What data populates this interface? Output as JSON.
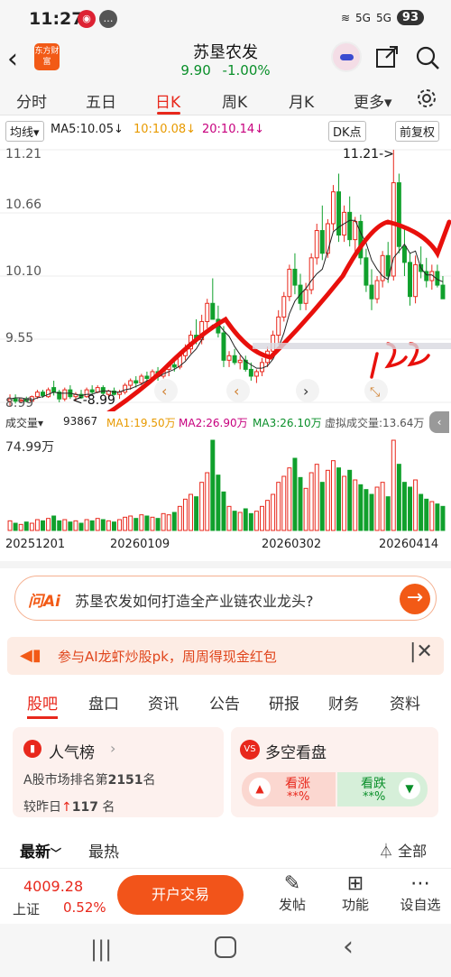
{
  "status": {
    "time": "11:27",
    "net1": "5G",
    "net2": "5G",
    "battery": "93"
  },
  "header": {
    "logo": "东方财富",
    "title": "苏垦农发",
    "price": "9.90",
    "change": "-1.00%"
  },
  "tabs": [
    {
      "label": "分时"
    },
    {
      "label": "五日"
    },
    {
      "label": "日K"
    },
    {
      "label": "周K"
    },
    {
      "label": "月K"
    },
    {
      "label": "更多▾"
    }
  ],
  "ma_bar": {
    "selector": "均线▾",
    "ma5": "MA5:10.05↓",
    "ma10": "10:10.08↓",
    "ma20": "20:10.14↓",
    "dk": "DK点",
    "adjust": "前复权"
  },
  "chart_axis": {
    "y1": "11.21",
    "y2": "10.66",
    "y3": "10.10",
    "y4": "9.55",
    "y5": "8.99",
    "hi_label": "11.21->",
    "lo_label": "<-8.99"
  },
  "vol_bar": {
    "selector": "成交量▾",
    "vol": "93867",
    "ma1": "MA1:19.50万",
    "ma2": "MA2:26.90万",
    "ma3": "MA3:26.10万",
    "virtual": "虚拟成交量:13.64万",
    "max": "74.99万"
  },
  "dates": [
    "20251201",
    "20260109",
    "20260302",
    "20260414"
  ],
  "colors": {
    "up": "#e8281c",
    "down": "#10a02c",
    "ma5": "#222222",
    "ma10": "#e89a00",
    "ma20": "#c7007e",
    "accent": "#f25a16"
  },
  "ai": {
    "badge": "问Ai",
    "question": "苏垦农发如何打造全产业链农业龙头?"
  },
  "promo": {
    "text": "参与AI龙虾炒股pk，周周得现金红包"
  },
  "subtabs": [
    "股吧",
    "盘口",
    "资讯",
    "公告",
    "研报",
    "财务",
    "资料"
  ],
  "popularity": {
    "title": "人气榜",
    "rank_label": "A股市场排名第",
    "rank": "2151",
    "rank_unit": "名",
    "change_label": "较昨日",
    "change": "117",
    "change_unit": "名"
  },
  "sentiment": {
    "title": "多空看盘",
    "bull": "看涨",
    "bull_val": "**%",
    "bear": "看跌",
    "bear_val": "**%"
  },
  "sort": {
    "latest": "最新",
    "hot": "最热",
    "filter": "全部"
  },
  "bottom": {
    "index": "4009.28",
    "index_name": "上证",
    "index_change": "0.52%",
    "trade": "开户交易",
    "post": "发帖",
    "func": "功能",
    "watch": "设自选"
  },
  "chart_data": {
    "type": "candlestick",
    "ylim": [
      8.99,
      11.21
    ],
    "candles": [
      [
        9.0,
        9.06,
        8.96,
        9.02
      ],
      [
        9.02,
        9.06,
        8.98,
        9.0
      ],
      [
        9.0,
        9.03,
        8.99,
        9.01
      ],
      [
        9.02,
        9.04,
        8.99,
        9.0
      ],
      [
        9.0,
        9.05,
        8.99,
        9.04
      ],
      [
        9.04,
        9.1,
        9.02,
        9.08
      ],
      [
        9.08,
        9.1,
        9.03,
        9.05
      ],
      [
        9.04,
        9.12,
        9.03,
        9.1
      ],
      [
        9.12,
        9.18,
        9.05,
        9.08
      ],
      [
        9.08,
        9.1,
        8.99,
        9.02
      ],
      [
        9.02,
        9.12,
        9.0,
        9.1
      ],
      [
        9.1,
        9.14,
        9.02,
        9.04
      ],
      [
        9.04,
        9.08,
        9.0,
        9.06
      ],
      [
        9.06,
        9.1,
        9.02,
        9.03
      ],
      [
        9.04,
        9.12,
        9.03,
        9.1
      ],
      [
        9.1,
        9.14,
        9.06,
        9.08
      ],
      [
        9.08,
        9.14,
        9.07,
        9.12
      ],
      [
        9.12,
        9.14,
        9.05,
        9.07
      ],
      [
        9.06,
        9.1,
        9.03,
        9.09
      ],
      [
        9.09,
        9.12,
        9.05,
        9.06
      ],
      [
        9.06,
        9.1,
        9.02,
        9.08
      ],
      [
        9.08,
        9.16,
        9.06,
        9.14
      ],
      [
        9.14,
        9.2,
        9.1,
        9.18
      ],
      [
        9.18,
        9.22,
        9.12,
        9.16
      ],
      [
        9.16,
        9.24,
        9.14,
        9.22
      ],
      [
        9.22,
        9.26,
        9.16,
        9.2
      ],
      [
        9.2,
        9.28,
        9.18,
        9.26
      ],
      [
        9.26,
        9.3,
        9.18,
        9.22
      ],
      [
        9.22,
        9.3,
        9.2,
        9.28
      ],
      [
        9.28,
        9.34,
        9.22,
        9.32
      ],
      [
        9.32,
        9.38,
        9.26,
        9.3
      ],
      [
        9.3,
        9.42,
        9.28,
        9.4
      ],
      [
        9.4,
        9.5,
        9.36,
        9.46
      ],
      [
        9.46,
        9.62,
        9.42,
        9.58
      ],
      [
        9.58,
        9.72,
        9.5,
        9.54
      ],
      [
        9.54,
        9.76,
        9.5,
        9.7
      ],
      [
        9.7,
        9.9,
        9.64,
        9.86
      ],
      [
        9.86,
        10.08,
        9.8,
        9.72
      ],
      [
        9.72,
        9.84,
        9.56,
        9.6
      ],
      [
        9.6,
        9.66,
        9.3,
        9.36
      ],
      [
        9.36,
        9.44,
        9.3,
        9.4
      ],
      [
        9.4,
        9.46,
        9.32,
        9.34
      ],
      [
        9.34,
        9.4,
        9.28,
        9.36
      ],
      [
        9.36,
        9.4,
        9.26,
        9.28
      ],
      [
        9.28,
        9.34,
        9.18,
        9.22
      ],
      [
        9.22,
        9.28,
        9.16,
        9.26
      ],
      [
        9.26,
        9.38,
        9.22,
        9.34
      ],
      [
        9.34,
        9.48,
        9.3,
        9.44
      ],
      [
        9.44,
        9.62,
        9.4,
        9.58
      ],
      [
        9.58,
        9.8,
        9.5,
        9.74
      ],
      [
        9.74,
        9.96,
        9.7,
        9.92
      ],
      [
        9.92,
        10.2,
        9.88,
        10.16
      ],
      [
        10.16,
        10.3,
        9.94,
        10.02
      ],
      [
        10.02,
        10.12,
        9.8,
        9.86
      ],
      [
        9.86,
        10.04,
        9.8,
        9.98
      ],
      [
        9.98,
        10.3,
        9.94,
        10.26
      ],
      [
        10.26,
        10.56,
        10.2,
        10.5
      ],
      [
        10.5,
        10.72,
        10.24,
        10.3
      ],
      [
        10.3,
        10.6,
        10.26,
        10.56
      ],
      [
        10.56,
        10.9,
        10.5,
        10.84
      ],
      [
        10.84,
        11.0,
        10.4,
        10.46
      ],
      [
        10.46,
        10.72,
        10.4,
        10.66
      ],
      [
        10.66,
        10.8,
        10.36,
        10.42
      ],
      [
        10.42,
        10.62,
        10.3,
        10.58
      ],
      [
        10.58,
        10.64,
        10.2,
        10.26
      ],
      [
        10.26,
        10.34,
        9.96,
        10.02
      ],
      [
        10.02,
        10.16,
        9.8,
        9.9
      ],
      [
        9.9,
        10.1,
        9.86,
        10.06
      ],
      [
        10.06,
        10.32,
        10.0,
        10.28
      ],
      [
        10.28,
        10.4,
        10.04,
        10.1
      ],
      [
        10.1,
        11.21,
        10.06,
        10.92
      ],
      [
        10.92,
        11.0,
        10.3,
        10.36
      ],
      [
        10.36,
        10.52,
        10.1,
        10.22
      ],
      [
        10.22,
        10.3,
        9.84,
        9.92
      ],
      [
        9.92,
        10.28,
        9.86,
        10.2
      ],
      [
        10.2,
        10.36,
        10.08,
        10.14
      ],
      [
        10.14,
        10.26,
        10.0,
        10.06
      ],
      [
        10.06,
        10.2,
        9.98,
        10.14
      ],
      [
        10.14,
        10.2,
        10.0,
        10.02
      ],
      [
        10.02,
        10.1,
        9.94,
        9.9
      ]
    ],
    "volumes": [
      8,
      6,
      5,
      7,
      6,
      9,
      8,
      10,
      12,
      8,
      9,
      7,
      8,
      6,
      9,
      8,
      10,
      9,
      8,
      7,
      9,
      11,
      12,
      10,
      13,
      12,
      11,
      10,
      14,
      13,
      15,
      20,
      26,
      30,
      28,
      40,
      48,
      75,
      46,
      32,
      20,
      16,
      15,
      18,
      14,
      16,
      20,
      25,
      30,
      40,
      45,
      52,
      60,
      44,
      35,
      48,
      55,
      40,
      50,
      58,
      52,
      45,
      50,
      42,
      38,
      34,
      30,
      36,
      40,
      28,
      75,
      55,
      40,
      36,
      42,
      30,
      26,
      24,
      22,
      20
    ],
    "ma5": [
      9.02,
      9.03,
      9.03,
      9.02,
      9.01,
      9.03,
      9.04,
      9.06,
      9.08,
      9.07,
      9.07,
      9.07,
      9.06,
      9.05,
      9.06,
      9.06,
      9.08,
      9.09,
      9.09,
      9.08,
      9.08,
      9.1,
      9.11,
      9.13,
      9.15,
      9.18,
      9.2,
      9.21,
      9.24,
      9.26,
      9.28,
      9.31,
      9.35,
      9.41,
      9.46,
      9.54,
      9.63,
      9.67,
      9.68,
      9.62,
      9.57,
      9.48,
      9.41,
      9.35,
      9.32,
      9.29,
      9.29,
      9.31,
      9.37,
      9.47,
      9.6,
      9.77,
      9.88,
      9.94,
      9.99,
      10.06,
      10.12,
      10.16,
      10.32,
      10.49,
      10.53,
      10.56,
      10.59,
      10.59,
      10.48,
      10.39,
      10.24,
      10.16,
      10.1,
      10.07,
      10.26,
      10.32,
      10.38,
      10.3,
      10.32,
      10.17,
      10.11,
      10.11,
      10.07,
      10.05
    ]
  }
}
